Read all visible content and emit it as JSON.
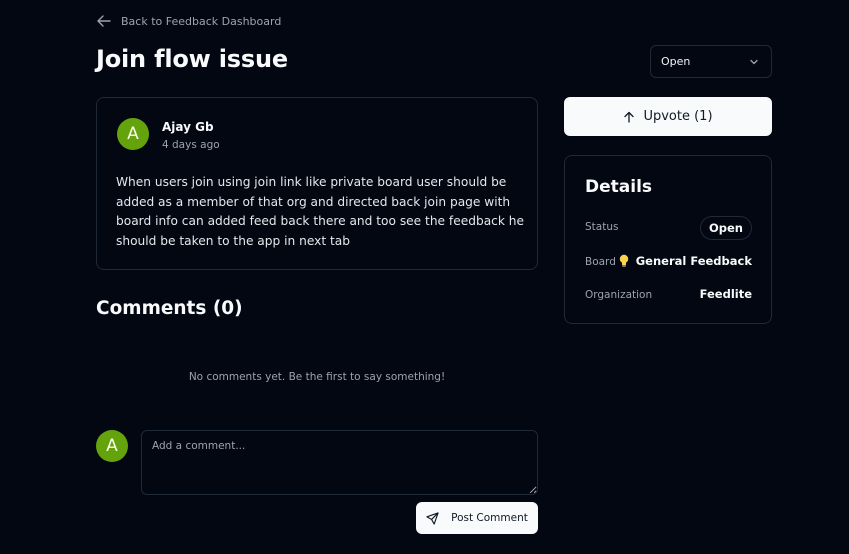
{
  "nav": {
    "back_label": "Back to Feedback Dashboard"
  },
  "feedback": {
    "title": "Join flow issue",
    "status_select": "Open",
    "author": {
      "initial": "A",
      "name": "Ajay Gb",
      "time": "4 days ago"
    },
    "body": "When users join using join link like private board user should be added as a member of that org and directed back join page with board info can added feed back there and too see the feedback he should be taken to the app in next tab"
  },
  "upvote": {
    "label": "Upvote (1)",
    "count": 1
  },
  "details": {
    "title": "Details",
    "status_label": "Status",
    "status_value": "Open",
    "board_label": "Board",
    "board_value": "General Feedback",
    "board_icon": "lightbulb-icon",
    "org_label": "Organization",
    "org_value": "Feedlite"
  },
  "comments": {
    "title": "Comments (0)",
    "empty_text": "No comments yet. Be the first to say something!",
    "user_initial": "A",
    "placeholder": "Add a comment...",
    "post_label": "Post Comment"
  },
  "colors": {
    "background": "#030712",
    "border": "#1f2937",
    "avatar": "#65a30d",
    "button": "#f8fafc"
  }
}
